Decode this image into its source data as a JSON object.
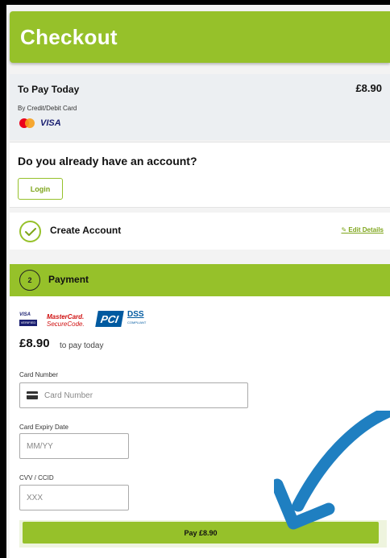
{
  "header": {
    "title": "Checkout"
  },
  "summary": {
    "label": "To Pay Today",
    "amount": "£8.90",
    "method": "By Credit/Debit Card",
    "visa": "VISA"
  },
  "account": {
    "question": "Do you already have an account?",
    "login_label": "Login"
  },
  "create_account": {
    "label": "Create Account",
    "edit_label": "Edit Details"
  },
  "payment": {
    "step": "2",
    "title": "Payment",
    "logos": {
      "visa_top": "VISA",
      "visa_bottom": "VERIFIED",
      "mc_line1": "MasterCard.",
      "mc_line2": "SecureCode.",
      "pci": "PCI",
      "dss": "DSS",
      "compliant": "COMPLIANT"
    },
    "amount": "£8.90",
    "amount_suffix": "to pay today",
    "card_number": {
      "label": "Card Number",
      "placeholder": "Card Number",
      "value": ""
    },
    "expiry": {
      "label": "Card Expiry Date",
      "placeholder": "MM/YY",
      "value": ""
    },
    "cvv": {
      "label": "CVV / CCID",
      "placeholder": "XXX",
      "value": ""
    },
    "pay_button": "Pay £8.90"
  },
  "colors": {
    "accent": "#96c12a",
    "arrow": "#1f7fc1"
  }
}
